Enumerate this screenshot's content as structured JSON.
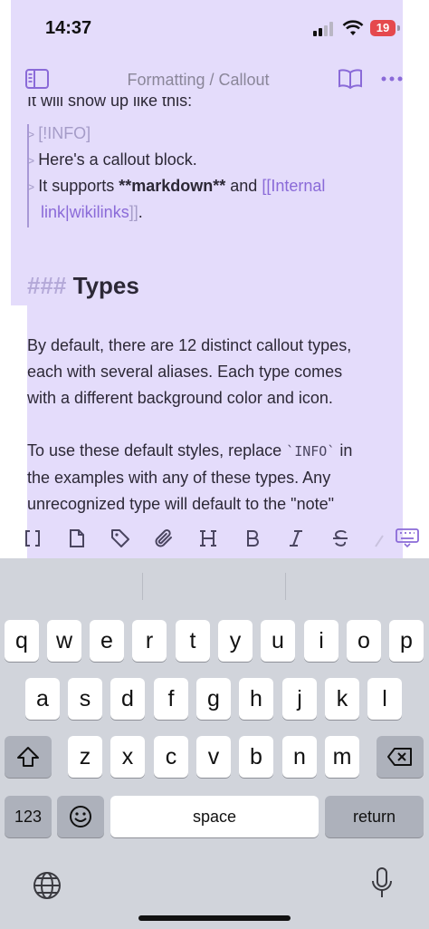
{
  "status": {
    "time": "14:37",
    "battery": "19"
  },
  "nav": {
    "title": "Formatting / Callout"
  },
  "note": {
    "intro": "It will show up like this:",
    "callout": {
      "line1": "[!INFO]",
      "line2": "Here's a callout block.",
      "line3_pre": "It supports ",
      "line3_bold": "**markdown**",
      "line3_mid": " and ",
      "line3_link": "[[Internal",
      "line4_link": "link|wikilinks",
      "line4_close": "]]",
      "line4_end": "."
    },
    "heading_hash": "###",
    "heading": "Types",
    "para1": [
      "By default, there are 12 distinct callout types,",
      "each with several aliases. Each type comes",
      "with a different background color and icon."
    ],
    "para2_l1_pre": "To use these default styles, replace ",
    "para2_l1_code": "`INFO`",
    "para2_l1_post": " in",
    "para2_l2": "the examples with any of these types. Any",
    "para2_l3": "unrecognized type will default to the \"note\""
  },
  "toolbar": [
    "brackets-icon",
    "file-icon",
    "tag-icon",
    "paperclip-icon",
    "heading-icon",
    "bold-icon",
    "italic-icon",
    "strikethrough-icon",
    "highlight-icon",
    "keyboard-hide-icon"
  ],
  "keyboard": {
    "row1": [
      "q",
      "w",
      "e",
      "r",
      "t",
      "y",
      "u",
      "i",
      "o",
      "p"
    ],
    "row2": [
      "a",
      "s",
      "d",
      "f",
      "g",
      "h",
      "j",
      "k",
      "l"
    ],
    "row3": [
      "z",
      "x",
      "c",
      "v",
      "b",
      "n",
      "m"
    ],
    "numbers": "123",
    "space": "space",
    "return": "return"
  },
  "colors": {
    "highlight": "#e4dcfb",
    "link": "#8a6ad8",
    "keyboard_bg": "#d1d4db"
  }
}
